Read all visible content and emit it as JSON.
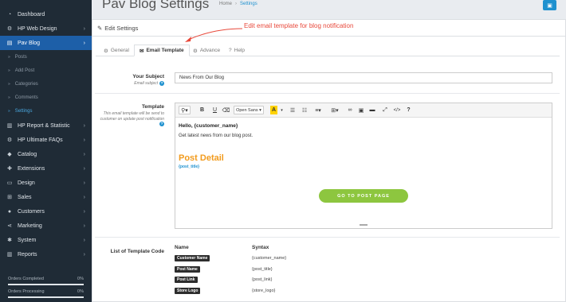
{
  "sidebar": {
    "items": [
      {
        "label": "Dashboard",
        "icon": "dashboard-icon",
        "glyph": "◔",
        "chevron": false
      },
      {
        "label": "HP Web Design",
        "icon": "cogs-icon",
        "glyph": "⚙",
        "chevron": true
      },
      {
        "label": "Pav Blog",
        "icon": "blog-icon",
        "glyph": "▤",
        "chevron": true,
        "active": true
      },
      {
        "label": "HP Report & Statistic",
        "icon": "bar-chart-icon",
        "glyph": "▥",
        "chevron": true
      },
      {
        "label": "HP Ultimate FAQs",
        "icon": "cogs-icon",
        "glyph": "⚙",
        "chevron": true
      },
      {
        "label": "Catalog",
        "icon": "tag-icon",
        "glyph": "◆",
        "chevron": true
      },
      {
        "label": "Extensions",
        "icon": "puzzle-icon",
        "glyph": "✚",
        "chevron": true
      },
      {
        "label": "Design",
        "icon": "monitor-icon",
        "glyph": "▭",
        "chevron": true
      },
      {
        "label": "Sales",
        "icon": "cart-icon",
        "glyph": "⊞",
        "chevron": true
      },
      {
        "label": "Customers",
        "icon": "user-icon",
        "glyph": "●",
        "chevron": true
      },
      {
        "label": "Marketing",
        "icon": "share-icon",
        "glyph": "⋖",
        "chevron": true
      },
      {
        "label": "System",
        "icon": "cog-icon",
        "glyph": "✱",
        "chevron": true
      },
      {
        "label": "Reports",
        "icon": "bar-chart-icon",
        "glyph": "▥",
        "chevron": true
      }
    ],
    "subitems": [
      {
        "label": "Posts"
      },
      {
        "label": "Add Post"
      },
      {
        "label": "Categories"
      },
      {
        "label": "Comments"
      },
      {
        "label": "Settings",
        "current": true
      }
    ],
    "stats": [
      {
        "label": "Orders Completed",
        "value": "0%"
      },
      {
        "label": "Orders Processing",
        "value": "0%"
      }
    ]
  },
  "header": {
    "title": "Pav Blog Settings",
    "breadcrumb": [
      "Home",
      "Settings"
    ],
    "save_icon": "save-icon"
  },
  "panel": {
    "heading": "Edit Settings",
    "annotation": "Edit email template for blog notification",
    "tabs": [
      {
        "label": "General",
        "icon": "cog-icon",
        "glyph": "⚙"
      },
      {
        "label": "Email Template",
        "icon": "envelope-icon",
        "glyph": "✉",
        "active": true
      },
      {
        "label": "Advance",
        "icon": "cogs-icon",
        "glyph": "⚙"
      },
      {
        "label": "Help",
        "icon": "question-icon",
        "glyph": "?"
      }
    ],
    "subject": {
      "label": "Your Subject",
      "help": "Email subject",
      "value": "News From Our Blog"
    },
    "template": {
      "label": "Template",
      "help": "This email template will be send to customer on update post notification"
    }
  },
  "editor": {
    "toolbar": {
      "font": "Open Sans"
    },
    "content": {
      "hello": "Hello, {customer_name}",
      "intro": "Get latest news from our blog post.",
      "post_heading": "Post Detail",
      "post_title": "{post_title}",
      "button": "GO TO POST PAGE"
    }
  },
  "codes": {
    "label": "List of Template Code",
    "col_name": "Name",
    "col_syntax": "Syntax",
    "rows": [
      {
        "name": "Customer Name",
        "syntax": "{customer_name}"
      },
      {
        "name": "Post Name",
        "syntax": "{post_title}"
      },
      {
        "name": "Post Link",
        "syntax": "{post_link}"
      },
      {
        "name": "Store Logo",
        "syntax": "{store_logo}"
      }
    ]
  },
  "colors": {
    "sidebar_bg": "#1f2b36",
    "active_bg": "#1d5fa8",
    "accent": "#1e91cf",
    "annotation": "#e8483a",
    "post_heading": "#f29b1d",
    "cta": "#8dc63f"
  }
}
